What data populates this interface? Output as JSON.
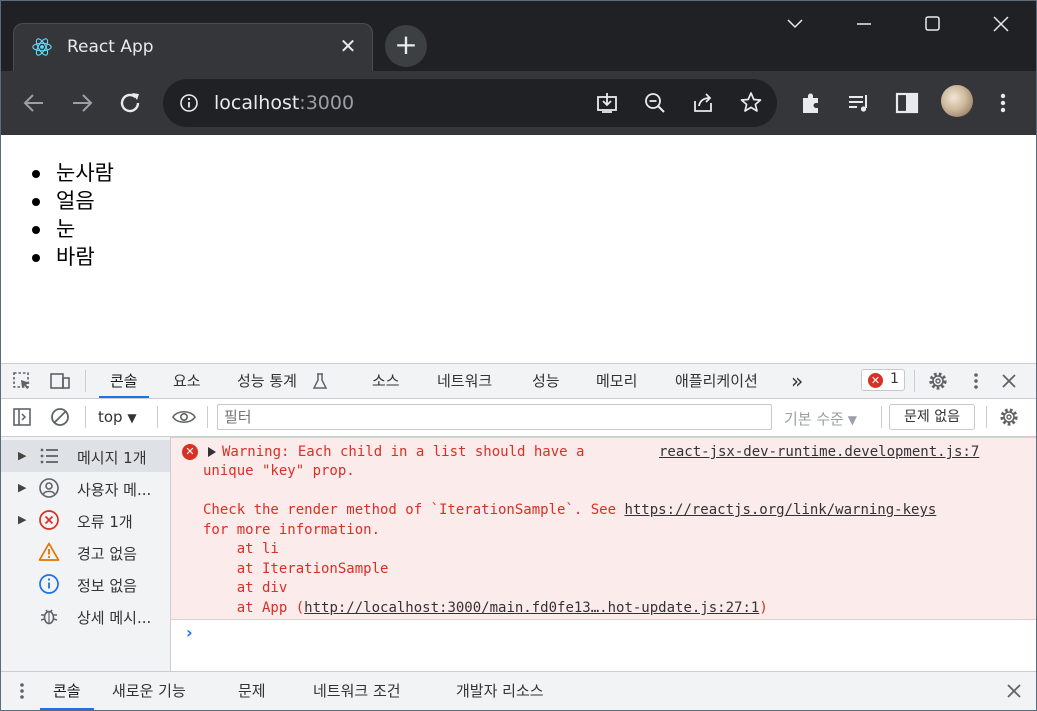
{
  "browser": {
    "tab_title": "React App",
    "tab_close": "✕",
    "new_tab": "+",
    "url_host": "localhost",
    "url_port": ":3000"
  },
  "page": {
    "items": [
      "눈사람",
      "얼음",
      "눈",
      "바람"
    ]
  },
  "devtools": {
    "tabs": [
      "콘솔",
      "요소",
      "성능 통계",
      "소스",
      "네트워크",
      "성능",
      "메모리",
      "애플리케이션"
    ],
    "more_tabs": "»",
    "error_count": "1",
    "context": "top",
    "filter_placeholder": "필터",
    "level": "기본 수준",
    "issues_button": "문제 없음",
    "sidebar": [
      {
        "label": "메시지 1개",
        "icon": "list-icon"
      },
      {
        "label": "사용자 메...",
        "icon": "user-icon"
      },
      {
        "label": "오류 1개",
        "icon": "error-icon"
      },
      {
        "label": "경고 없음",
        "icon": "warning-icon"
      },
      {
        "label": "정보 없음",
        "icon": "info-icon"
      },
      {
        "label": "상세 메시...",
        "icon": "bug-icon"
      }
    ],
    "message": {
      "line1": "Warning: Each child in a list should have a",
      "line2": "unique \"key\" prop.",
      "source": "react-jsx-dev-runtime.development.js:7",
      "line4_prefix": "Check the render method of `IterationSample`. See ",
      "line4_link": "https://reactjs.org/link/warning-keys",
      "line5": "for more information.",
      "stack1": "    at li",
      "stack2": "    at IterationSample",
      "stack3": "    at div",
      "stack4_prefix": "    at App (",
      "stack4_link": "http://localhost:3000/main.fd0fe13….hot-update.js:27:1",
      "stack4_suffix": ")"
    },
    "prompt": "›",
    "drawer_tabs": [
      "콘솔",
      "새로운 기능",
      "문제",
      "네트워크 조건",
      "개발자 리소스"
    ]
  },
  "colors": {
    "error": "#d93025",
    "accent": "#1a73e8",
    "warning": "#e37400"
  }
}
